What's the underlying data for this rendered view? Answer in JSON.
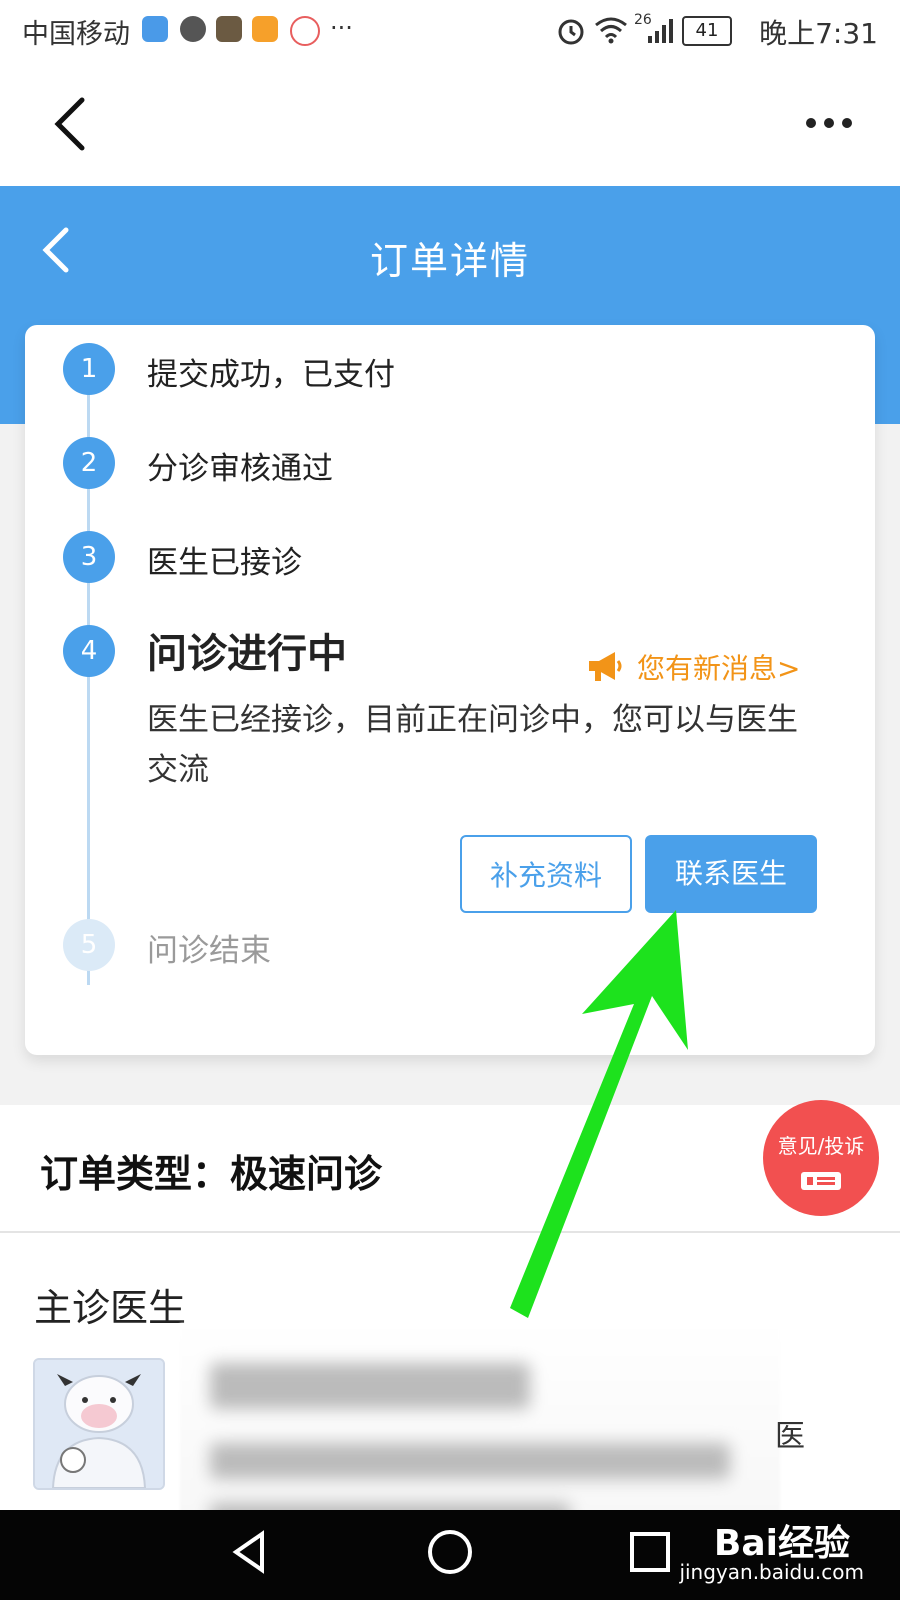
{
  "status_bar": {
    "carrier": "中国移动",
    "network": "26",
    "battery": "41",
    "time": "晚上7:31",
    "extra": "···",
    "icon_colors": [
      "#4a9ae8",
      "#555555",
      "#6b5a42",
      "#f6a02a",
      "#e85e5e"
    ]
  },
  "browser": {
    "back_icon": "chevron-left-icon",
    "more_icon": "more-dots-icon"
  },
  "header": {
    "title": "订单详情",
    "back_icon": "chevron-left-icon",
    "color": "#4aa0ea"
  },
  "steps": [
    {
      "num": "1",
      "label": "提交成功，已支付"
    },
    {
      "num": "2",
      "label": "分诊审核通过"
    },
    {
      "num": "3",
      "label": "医生已接诊"
    },
    {
      "num": "4",
      "label": "问诊进行中",
      "description": "医生已经接诊，目前正在问诊中，您可以与医生交流"
    },
    {
      "num": "5",
      "label": "问诊结束"
    }
  ],
  "new_message": "您有新消息>",
  "buttons": {
    "supplement": "补充资料",
    "contact": "联系医生"
  },
  "order": {
    "type_label": "订单类型：极速问诊"
  },
  "feedback": {
    "label": "意见/投诉"
  },
  "doctor": {
    "heading": "主诊医生",
    "trailing_text": "医"
  },
  "watermark": {
    "brand": "Bai经验",
    "url": "jingyan.baidu.com"
  },
  "colors": {
    "accent": "#4aa0ea",
    "orange": "#f29418",
    "arrow": "#1de21d",
    "feedback": "#f25050"
  }
}
